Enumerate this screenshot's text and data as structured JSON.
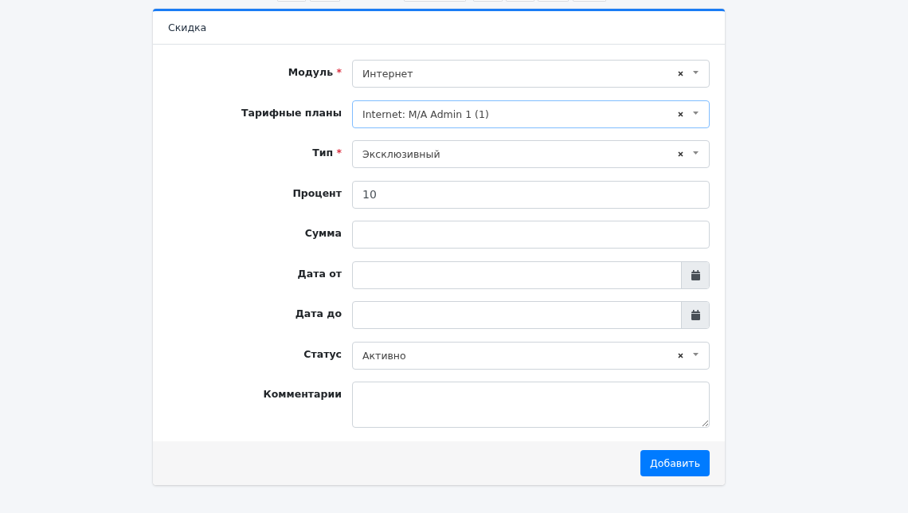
{
  "card": {
    "title": "Скидка"
  },
  "fields": [
    {
      "label": "Модуль",
      "required_mark": "*",
      "kind": "select",
      "value": "Интернет",
      "focused": false
    },
    {
      "label": "Тарифные планы",
      "kind": "select",
      "value": "Internet: M/A Admin 1 (1)",
      "focused": true
    },
    {
      "label": "Тип",
      "required_mark": "*",
      "kind": "select",
      "value": "Эксклюзивный",
      "focused": false
    },
    {
      "label": "Процент",
      "kind": "text",
      "value": "10",
      "focused": false
    },
    {
      "label": "Сумма",
      "kind": "text",
      "focused": false
    },
    {
      "label": "Дата от",
      "kind": "date",
      "focused": false
    },
    {
      "label": "Дата до",
      "kind": "date",
      "focused": false
    },
    {
      "label": "Статус",
      "kind": "select",
      "value": "Активно",
      "focused": false
    },
    {
      "label": "Комментарии",
      "kind": "textarea",
      "focused": false
    }
  ],
  "submit_button": {
    "label": "Добавить"
  }
}
